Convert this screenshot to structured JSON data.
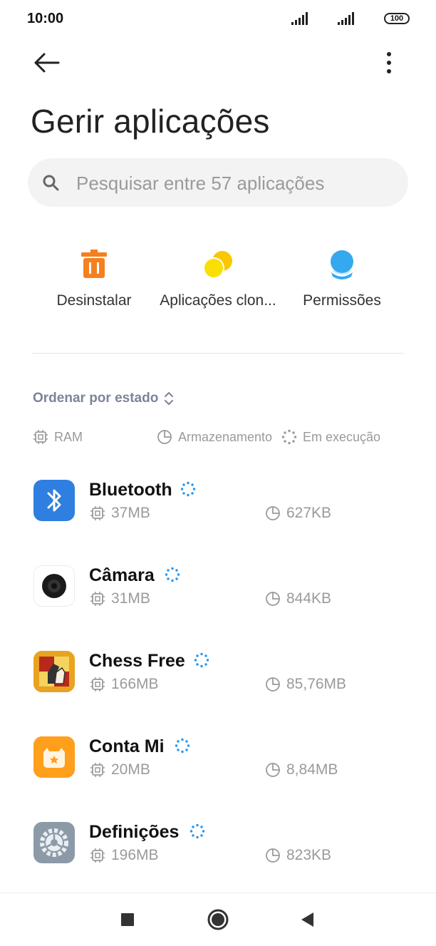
{
  "status_bar": {
    "time": "10:00",
    "battery": "100"
  },
  "header": {
    "title": "Gerir aplicações"
  },
  "search": {
    "placeholder": "Pesquisar entre 57 aplicações"
  },
  "actions": [
    {
      "label": "Desinstalar",
      "icon": "trash-icon",
      "color": "#f5801f"
    },
    {
      "label": "Aplicações clon...",
      "icon": "clone-icon",
      "color": "#f9c800"
    },
    {
      "label": "Permissões",
      "icon": "permissions-icon",
      "color": "#35a9f0"
    }
  ],
  "sort": {
    "label": "Ordenar por estado"
  },
  "legend": {
    "ram": "RAM",
    "storage": "Armazenamento",
    "running": "Em execução"
  },
  "apps": [
    {
      "name": "Bluetooth",
      "ram": "37MB",
      "storage": "627KB",
      "icon": "bluetooth-app-icon",
      "running": true
    },
    {
      "name": "Câmara",
      "ram": "31MB",
      "storage": "844KB",
      "icon": "camera-app-icon",
      "running": true
    },
    {
      "name": "Chess Free",
      "ram": "166MB",
      "storage": "85,76MB",
      "icon": "chess-app-icon",
      "running": true
    },
    {
      "name": "Conta Mi",
      "ram": "20MB",
      "storage": "8,84MB",
      "icon": "mi-account-app-icon",
      "running": true
    },
    {
      "name": "Definições",
      "ram": "196MB",
      "storage": "823KB",
      "icon": "settings-app-icon",
      "running": true
    }
  ],
  "colors": {
    "running_indicator": "#2196f3",
    "muted_text": "#9a9a9a",
    "sort_text": "#7c8497"
  }
}
